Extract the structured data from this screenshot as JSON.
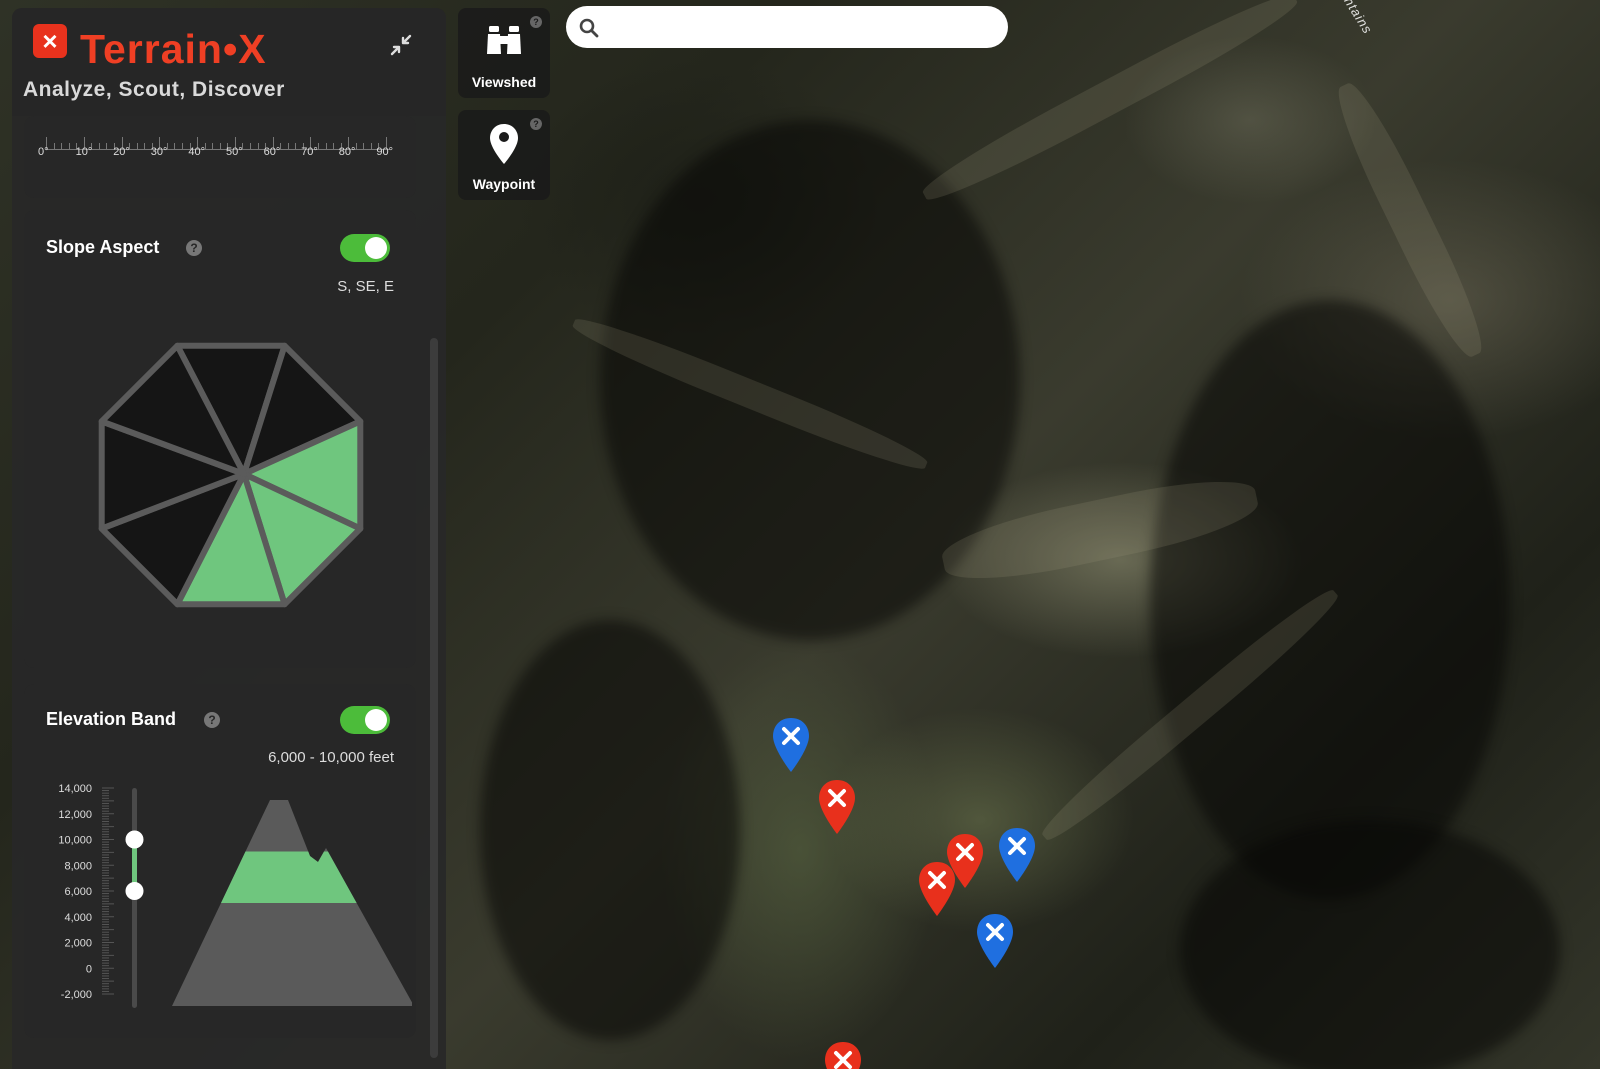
{
  "app": {
    "name": "Terrain•X",
    "logo_glyph": "×",
    "tagline": "Analyze, Scout, Discover"
  },
  "map": {
    "label": "ntains"
  },
  "slope_angle": {
    "labels": [
      "0°",
      "10°",
      "20°",
      "30°",
      "40°",
      "50°",
      "60°",
      "70°",
      "80°",
      "90°"
    ]
  },
  "slope_aspect": {
    "title": "Slope Aspect",
    "help": "?",
    "enabled": true,
    "value": "S, SE, E",
    "sectors": [
      "N",
      "NE",
      "E",
      "SE",
      "S",
      "SW",
      "W",
      "NW"
    ],
    "selected": [
      "E",
      "SE",
      "S"
    ],
    "colors": {
      "selected": "#6fc67e",
      "unselected": "#151515",
      "edge": "#5b5b5b"
    }
  },
  "elevation_band": {
    "title": "Elevation Band",
    "help": "?",
    "enabled": true,
    "value": "6,000 - 10,000 feet",
    "axis_labels": [
      "14,000",
      "12,000",
      "10,000",
      "8,000",
      "6,000",
      "4,000",
      "2,000",
      "0",
      "-2,000"
    ],
    "range_min": 6000,
    "range_max": 10000,
    "axis_min": -2000,
    "axis_max": 14000,
    "colors": {
      "band": "#6fc67e",
      "mountain": "#5a5a5a"
    }
  },
  "tools": {
    "viewshed": {
      "label": "Viewshed",
      "help": "?"
    },
    "waypoint": {
      "label": "Waypoint",
      "help": "?"
    }
  },
  "search": {
    "value": "",
    "placeholder": ""
  },
  "markers": [
    {
      "color": "blue",
      "icon": "x"
    },
    {
      "color": "red",
      "icon": "x"
    },
    {
      "color": "red",
      "icon": "x"
    },
    {
      "color": "red",
      "icon": "x"
    },
    {
      "color": "blue",
      "icon": "x"
    },
    {
      "color": "blue",
      "icon": "x"
    },
    {
      "color": "red",
      "icon": "x"
    }
  ],
  "colors": {
    "brand": "#ef3f24",
    "toggle_on": "#4cbc3a",
    "marker_red": "#e8301c",
    "marker_blue": "#1f6fe0"
  }
}
